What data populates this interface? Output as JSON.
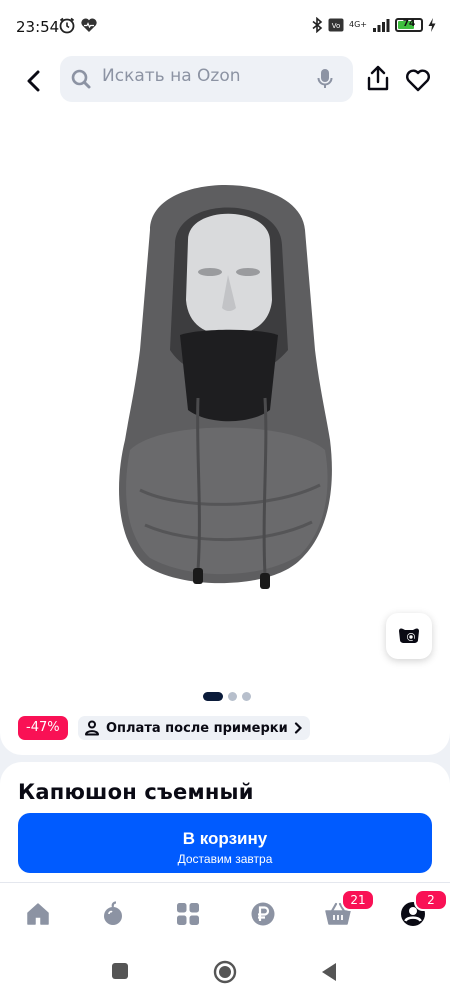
{
  "status_bar": {
    "time": "23:54",
    "network": "4G+",
    "battery_level": "74",
    "battery_fraction": 0.74
  },
  "header": {
    "search_placeholder": "Искать на Ozon"
  },
  "product": {
    "discount": "-47%",
    "fitting_label": "Оплата после примерки",
    "title": "Капюшон съемный",
    "gallery_pages": 3,
    "gallery_active": 1
  },
  "cart_button": {
    "label": "В корзину",
    "sub_label": "Доставим завтра"
  },
  "bottom_nav": {
    "cart_badge": "21",
    "profile_badge": "2"
  },
  "colors": {
    "brand_blue": "#005bff",
    "badge_pink": "#f91155",
    "background": "#eef1f6"
  },
  "icons": [
    "back-arrow-icon",
    "search-icon",
    "microphone-icon",
    "share-icon",
    "heart-icon",
    "visual-search-icon",
    "fitting-person-icon",
    "chevron-right-icon",
    "home-icon",
    "fresh-icon",
    "catalog-icon",
    "ruble-icon",
    "basket-icon",
    "profile-icon"
  ]
}
